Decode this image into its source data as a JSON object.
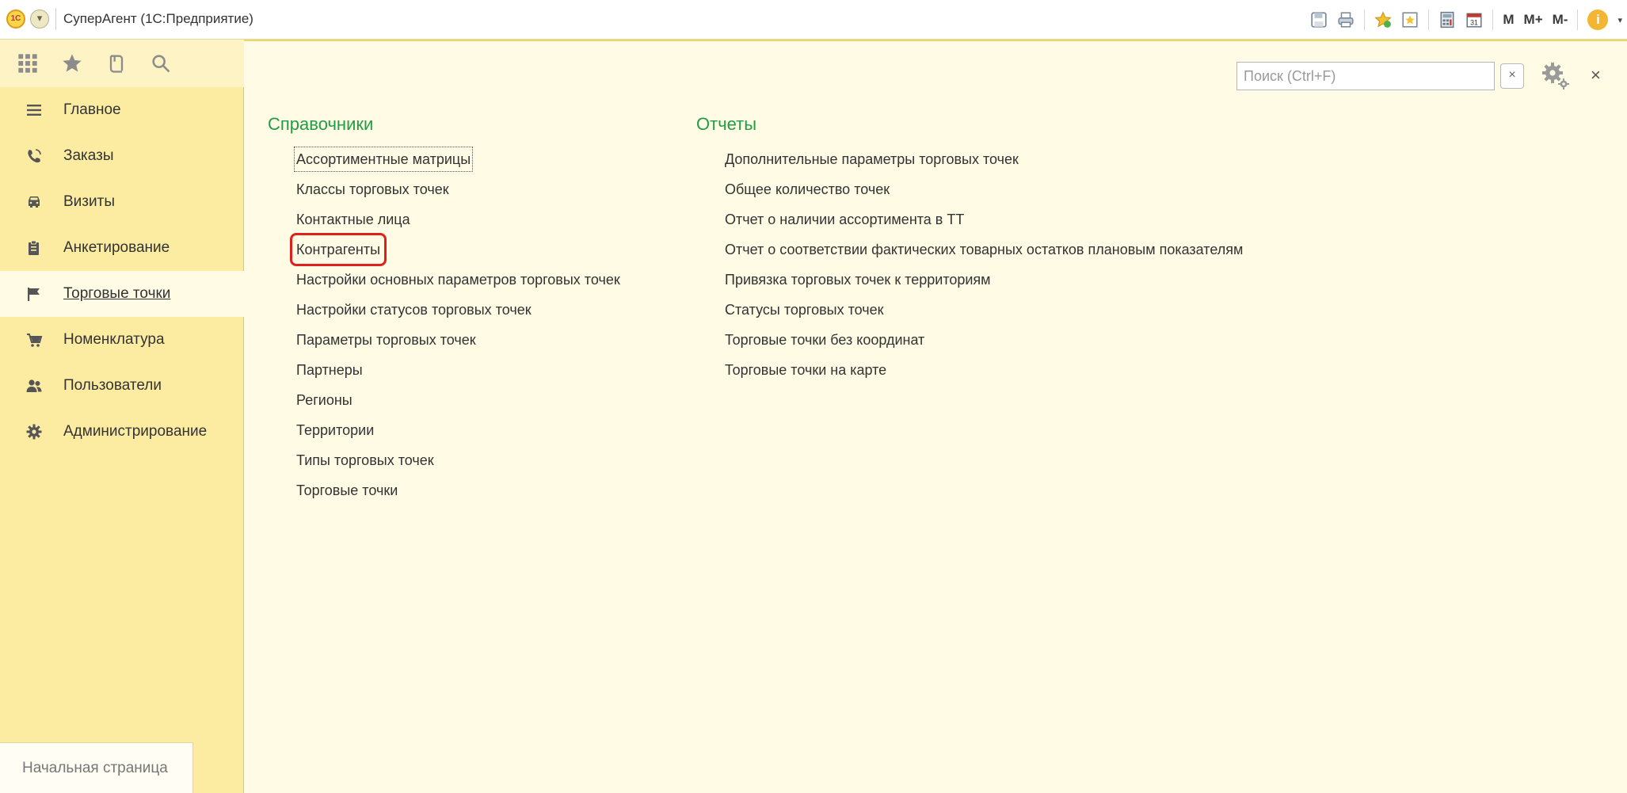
{
  "titlebar": {
    "app_title": "СуперАгент  (1С:Предприятие)",
    "logo_text": "1С",
    "memory_buttons": [
      "M",
      "M+",
      "M-"
    ]
  },
  "sidebar": {
    "items": [
      {
        "label": "Главное",
        "icon": "menu-lines-icon"
      },
      {
        "label": "Заказы",
        "icon": "phone-icon"
      },
      {
        "label": "Визиты",
        "icon": "car-icon"
      },
      {
        "label": "Анкетирование",
        "icon": "clipboard-icon"
      },
      {
        "label": "Торговые точки",
        "icon": "flag-icon",
        "active": true
      },
      {
        "label": "Номенклатура",
        "icon": "cart-icon"
      },
      {
        "label": "Пользователи",
        "icon": "users-icon"
      },
      {
        "label": "Администрирование",
        "icon": "gear-icon"
      }
    ],
    "home_tab": "Начальная страница"
  },
  "search": {
    "placeholder": "Поиск (Ctrl+F)",
    "value": ""
  },
  "directories": {
    "title": "Справочники",
    "items": [
      "Ассортиментные матрицы",
      "Классы торговых точек",
      "Контактные лица",
      "Контрагенты",
      "Настройки основных параметров торговых точек",
      "Настройки статусов торговых точек",
      "Параметры торговых точек",
      "Партнеры",
      "Регионы",
      "Территории",
      "Типы торговых точек",
      "Торговые точки"
    ]
  },
  "reports": {
    "title": "Отчеты",
    "items": [
      "Дополнительные параметры торговых точек",
      "Общее количество точек",
      "Отчет о наличии ассортимента в ТТ",
      "Отчет о соответствии фактических товарных остатков плановым показателям",
      "Привязка торговых точек к территориям",
      "Статусы торговых точек",
      "Торговые точки без координат",
      "Торговые точки на карте"
    ]
  },
  "colors": {
    "accent_green": "#1f9e45",
    "highlight_red": "#e0201c",
    "sidebar_bg": "#fbeca2",
    "main_bg": "#fffbe5"
  }
}
